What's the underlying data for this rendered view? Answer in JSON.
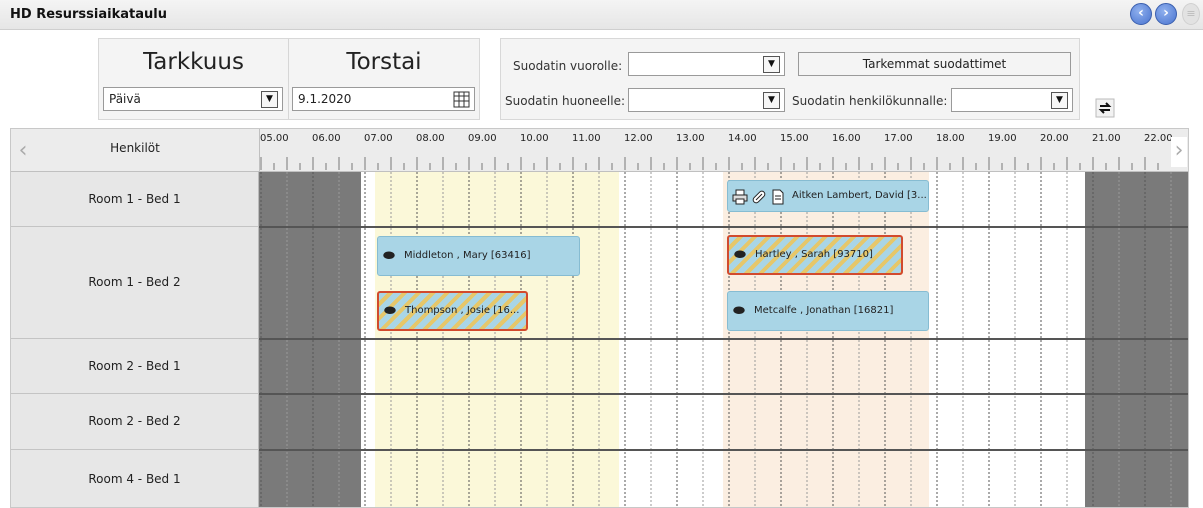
{
  "window": {
    "title": "HD Resurssiaikataulu"
  },
  "accuracy": {
    "heading": "Tarkkuus",
    "value": "Päivä"
  },
  "day": {
    "heading": "Torstai",
    "date": "9.1.2020"
  },
  "filters": {
    "shift_label": "Suodatin vuorolle:",
    "room_label": "Suodatin huoneelle:",
    "staff_label": "Suodatin henkilökunnalle:",
    "advanced_label": "Tarkemmat suodattimet"
  },
  "timeline": {
    "people_label": "Henkilöt",
    "hours": [
      "05.00",
      "06.00",
      "07.00",
      "08.00",
      "09.00",
      "10.00",
      "11.00",
      "12.00",
      "13.00",
      "14.00",
      "15.00",
      "16.00",
      "17.00",
      "18.00",
      "19.00",
      "20.00",
      "21.00",
      "22.00"
    ]
  },
  "rows": [
    "Room 1 - Bed 1",
    "Room 1 - Bed 2",
    "Room 2 - Bed 1",
    "Room 2 - Bed 2",
    "Room 4 - Bed 1"
  ],
  "appointments": [
    {
      "label": "Aitken Lambert, David [3...",
      "style": "blue"
    },
    {
      "label": "Middleton , Mary [63416]",
      "style": "blue"
    },
    {
      "label": "Hartley , Sarah [93710]",
      "style": "striped"
    },
    {
      "label": "Thompson , Josie [16...",
      "style": "striped"
    },
    {
      "label": "Metcalfe , Jonathan [16821]",
      "style": "blue"
    }
  ],
  "colors": {
    "accent": "#4a74cf",
    "appointment": "#a9d5e6",
    "stripe": "#e6c76a",
    "alert_border": "#d24a2d"
  }
}
